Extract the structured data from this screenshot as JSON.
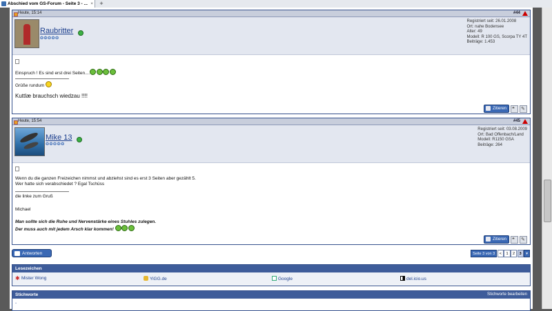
{
  "browser": {
    "tab_title": "Abschied vom GS-Forum - Seite 3 - ...",
    "tab_close": "×",
    "new_tab": "+"
  },
  "posts": [
    {
      "date": "Heute, 15:14",
      "number": "#44",
      "username": "Raubritter",
      "stars": "❂❂❂❂❂",
      "info": [
        "Registriert seit: 26.01.2008",
        "Ort: nahe Bodensee",
        "Alter: 49",
        "Modell: R 100 GS, Scorpa TY 4T",
        "Beiträge: 1.453"
      ],
      "lines": [
        "Einspruch ! Es sind erst drei Seiten...."
      ],
      "sig": [
        "Grüße rundum",
        "Kuttlæ brauchsch wiedzau !!!!"
      ],
      "quote_label": "Zitieren"
    },
    {
      "date": "Heute, 15:54",
      "number": "#45",
      "username": "Mike 13",
      "stars": "❂❂❂❂❂",
      "info": [
        "Registriert seit: 03.08.2009",
        "Ort: Bad Offenbach/Land",
        "Modell: R1150 GSA",
        "Beiträge: 264"
      ],
      "lines": [
        "Wenn du die ganzen Freizeichen nimmst und abziehst sind es erst 3 Seiten aber gezählt 5.",
        "Wer hatte sich verabschiedet ? Egal Tschüss"
      ],
      "sig": [
        "die linke zum Gruß",
        "Michael",
        "Man sollte sich die Ruhe und Nervenstärke eines Stuhles zulegen.",
        "Der muss auch mit jedem Arsch klar kommen!"
      ],
      "quote_label": "Zitieren"
    }
  ],
  "reply_label": "Antworten",
  "pagenav": {
    "label": "Seite 3 von 3",
    "prev": "<",
    "p1": "1",
    "p2": "2",
    "p3": "3",
    "drop": "▾"
  },
  "bookmarks": {
    "title": "Lesezeichen",
    "items": [
      "Mister Wong",
      "YiGG.de",
      "Google",
      "del.icio.us"
    ]
  },
  "tags": {
    "title": "Stichworte",
    "edit": "Stichworte bearbeiten",
    "value": "-"
  },
  "colors": {
    "accent": "#3e5c9a",
    "link": "#1a3d8c",
    "head": "#c8cedc"
  }
}
